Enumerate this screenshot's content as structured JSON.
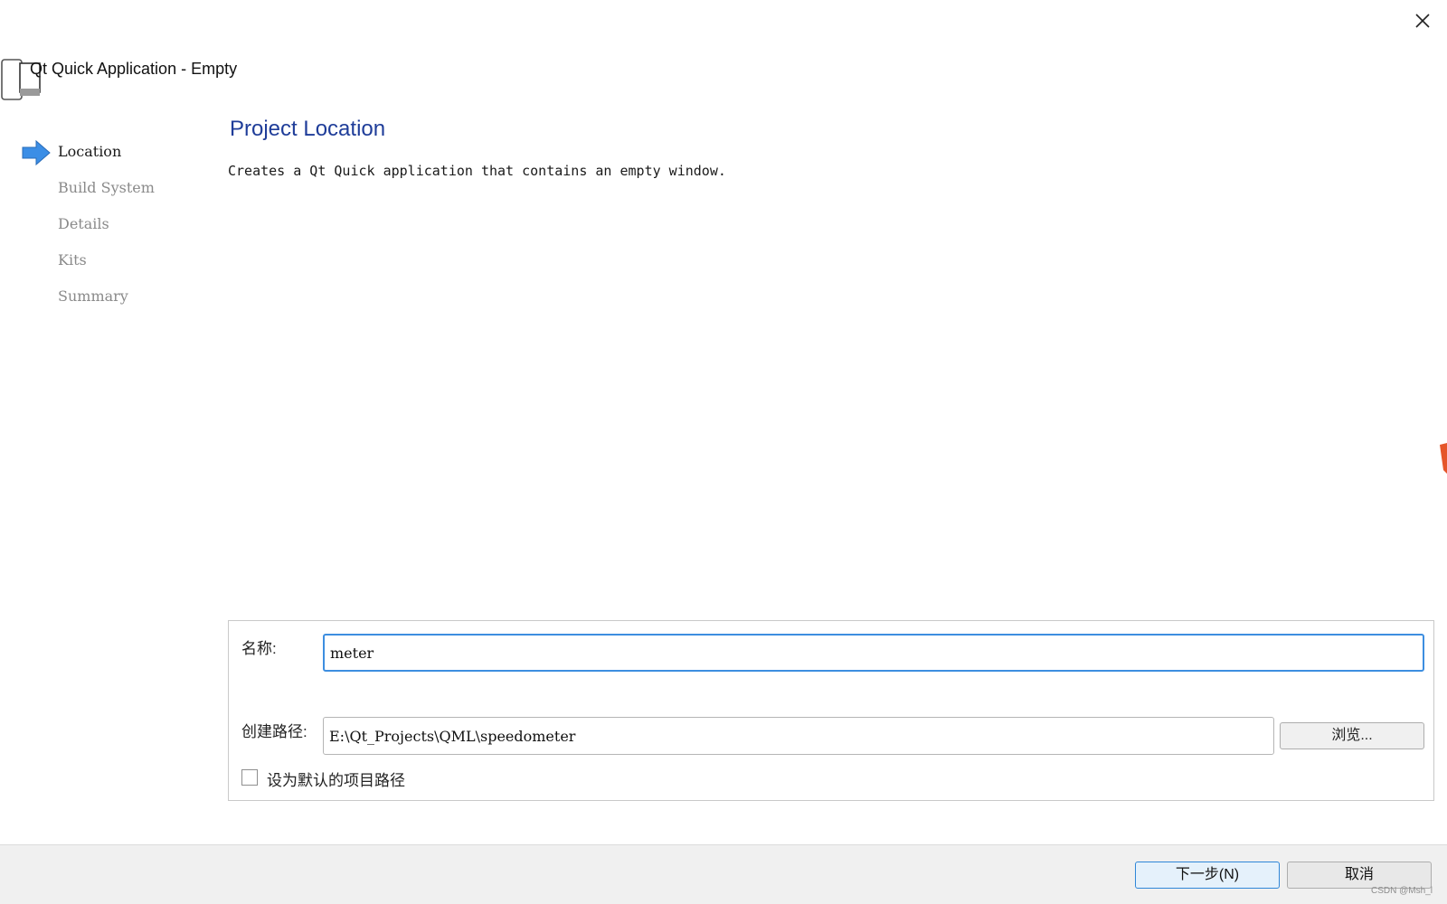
{
  "window": {
    "title": "Qt Quick Application - Empty",
    "icons": {
      "close": "close-icon",
      "app": "app-window-icon"
    }
  },
  "sidebar": {
    "active_index": 0,
    "items": [
      {
        "label": "Location",
        "active": true
      },
      {
        "label": "Build System",
        "active": false
      },
      {
        "label": "Details",
        "active": false
      },
      {
        "label": "Kits",
        "active": false
      },
      {
        "label": "Summary",
        "active": false
      }
    ]
  },
  "main": {
    "title": "Project Location",
    "description": "Creates a Qt Quick application that contains an empty window."
  },
  "form": {
    "name_label": "名称:",
    "name_value": "meter",
    "path_label": "创建路径:",
    "path_value": "E:\\Qt_Projects\\QML\\speedometer",
    "browse_label": "浏览...",
    "default_checkbox_label": "设为默认的项目路径",
    "default_checked": false
  },
  "footer": {
    "next_label": "下一步(N)",
    "cancel_label": "取消"
  },
  "watermark": "CSDN @Msh_l",
  "colors": {
    "title_blue": "#1f3d99",
    "focus_blue": "#3d8ee0",
    "arrow_blue": "#3b8ee6"
  }
}
